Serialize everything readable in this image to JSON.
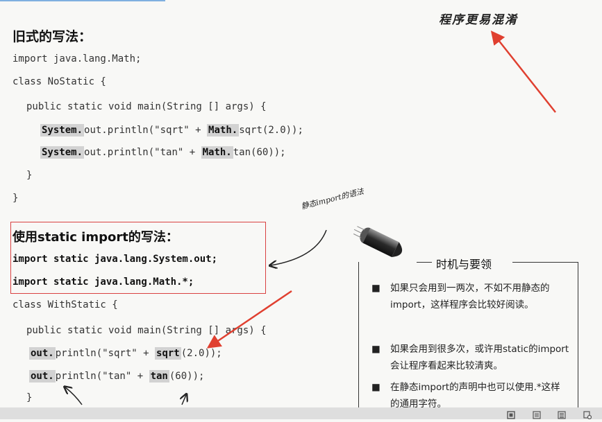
{
  "page": {
    "old_heading": "旧式的写法：",
    "old_code": {
      "line1": "import java.lang.Math;",
      "line2": "class NoStatic {",
      "line3": "public static void main(String [] args) {",
      "line4_a": "System.",
      "line4_b": "out.println(\"sqrt\" + ",
      "line4_c": "Math.",
      "line4_d": "sqrt(2.0));",
      "line5_a": "System.",
      "line5_b": "out.println(\"tan\" + ",
      "line5_c": "Math.",
      "line5_d": "tan(60));",
      "close1": "}",
      "close2": "}"
    },
    "annotation_top": "程序更易混淆",
    "annotation_static": "静态import的语法",
    "new_heading": "使用static import的写法：",
    "new_code": {
      "import1": "import static java.lang.System.out;",
      "import2": "import static java.lang.Math.*;",
      "line1": "class WithStatic {",
      "line2": "public static void main(String [] args) {",
      "line3_a": "out.",
      "line3_b": "println(\"sqrt\" + ",
      "line3_c": "sqrt",
      "line3_d": "(2.0));",
      "line4_a": "out.",
      "line4_b": "println(\"tan\" + ",
      "line4_c": "tan",
      "line4_d": "(60));",
      "close": "}"
    },
    "tips": {
      "title": "时机与要领",
      "items": [
        "如果只会用到一两次，不如不用静态的import，这样程序会比较好阅读。",
        "如果会用到很多次，或许用static的import会让程序看起来比较清爽。",
        "在静态import的声明中也可以使用.*这样的通用字符。"
      ],
      "bullet": "■"
    }
  },
  "colors": {
    "red_annotation": "#e04030",
    "highlight": "#d2d2d2"
  },
  "statusbar": {
    "icons": [
      "fit-page-icon",
      "single-page-icon",
      "two-page-icon",
      "settings-icon"
    ]
  }
}
